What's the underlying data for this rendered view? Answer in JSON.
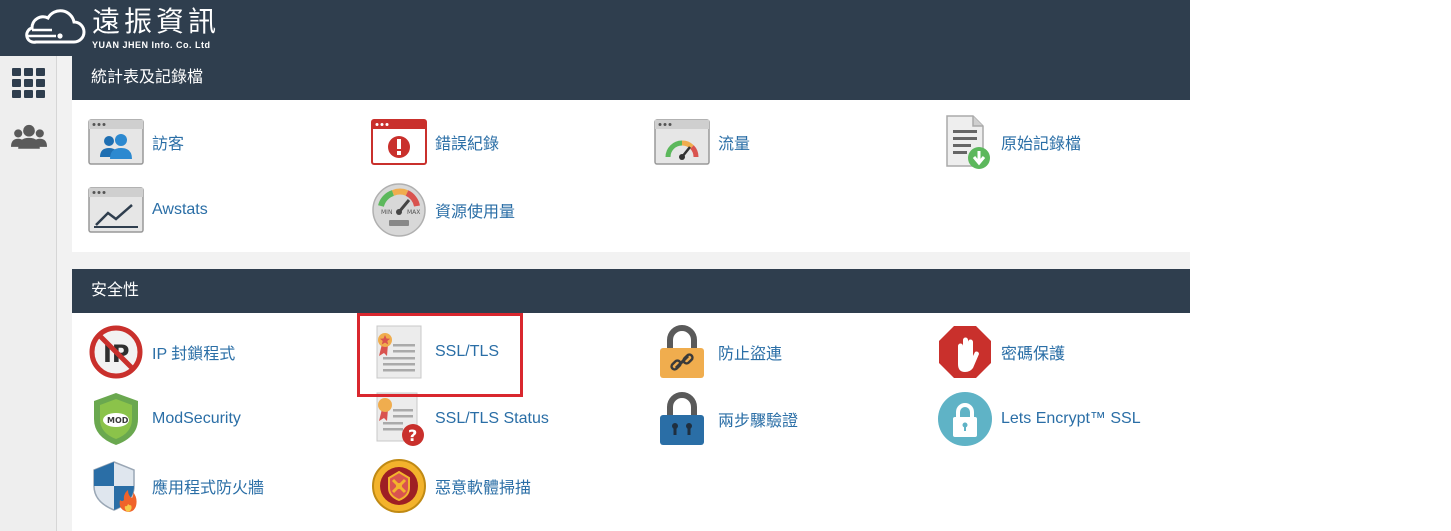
{
  "brand": {
    "name_cn": "遠振資訊",
    "name_en": "YUAN JHEN Info. Co. Ltd"
  },
  "sidebar": {
    "items": [
      {
        "icon": "grid-icon"
      },
      {
        "icon": "users-icon"
      }
    ]
  },
  "sections": [
    {
      "title": "統計表及記錄檔",
      "items": [
        {
          "label": "訪客",
          "icon": "visitors-icon"
        },
        {
          "label": "錯誤紀錄",
          "icon": "errors-icon"
        },
        {
          "label": "流量",
          "icon": "bandwidth-icon"
        },
        {
          "label": "原始記錄檔",
          "icon": "raw-access-icon"
        },
        {
          "label": "Awstats",
          "icon": "awstats-icon"
        },
        {
          "label": "資源使用量",
          "icon": "resource-usage-icon"
        }
      ]
    },
    {
      "title": "安全性",
      "items": [
        {
          "label": "IP 封鎖程式",
          "icon": "ip-blocker-icon"
        },
        {
          "label": "SSL/TLS",
          "icon": "ssl-tls-icon"
        },
        {
          "label": "防止盜連",
          "icon": "hotlink-protection-icon"
        },
        {
          "label": "密碼保護",
          "icon": "directory-privacy-icon"
        },
        {
          "label": "ModSecurity",
          "icon": "modsecurity-icon"
        },
        {
          "label": "SSL/TLS Status",
          "icon": "ssl-tls-status-icon"
        },
        {
          "label": "兩步驟驗證",
          "icon": "two-factor-icon"
        },
        {
          "label": "Lets Encrypt™ SSL",
          "icon": "lets-encrypt-icon"
        },
        {
          "label": "應用程式防火牆",
          "icon": "app-firewall-icon"
        },
        {
          "label": "惡意軟體掃描",
          "icon": "malware-scan-icon"
        }
      ]
    }
  ],
  "highlight_color": "#d9272e"
}
